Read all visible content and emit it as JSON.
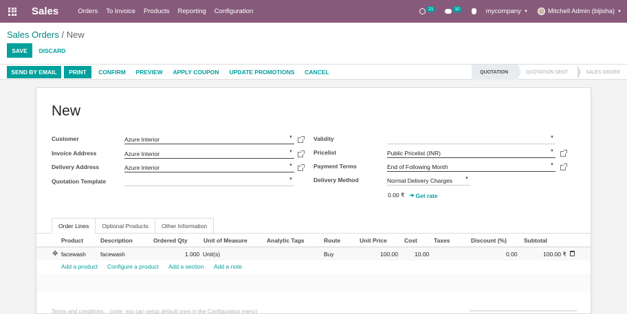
{
  "navbar": {
    "brand": "Sales",
    "menu": [
      "Orders",
      "To Invoice",
      "Products",
      "Reporting",
      "Configuration"
    ],
    "activity_count": "21",
    "messages_count": "10",
    "company": "mycompany",
    "user": "Mitchell Admin (bijisha)",
    "color": "#875a7b"
  },
  "control": {
    "breadcrumb_parent": "Sales Orders",
    "breadcrumb_sep": "/",
    "breadcrumb_current": "New",
    "save": "SAVE",
    "discard": "DISCARD"
  },
  "statusbar": {
    "send_by_email": "SEND BY EMAIL",
    "print": "PRINT",
    "confirm": "CONFIRM",
    "preview": "PREVIEW",
    "apply_coupon": "APPLY COUPON",
    "update_promotions": "UPDATE PROMOTIONS",
    "cancel": "CANCEL",
    "stages": [
      "QUOTATION",
      "QUOTATION SENT",
      "SALES ORDER"
    ],
    "active_stage": "QUOTATION"
  },
  "form": {
    "title": "New",
    "left": {
      "customer_label": "Customer",
      "customer_value": "Azure Interior",
      "invoice_label": "Invoice Address",
      "invoice_value": "Azure Interior",
      "delivery_label": "Delivery Address",
      "delivery_value": "Azure Interior",
      "template_label": "Quotation Template",
      "template_value": ""
    },
    "right": {
      "validity_label": "Validity",
      "validity_value": "",
      "pricelist_label": "Pricelist",
      "pricelist_value": "Public Pricelist (INR)",
      "payment_label": "Payment Terms",
      "payment_value": "End of Following Month",
      "delivery_method_label": "Delivery Method",
      "delivery_method_value": "Normal Delivery Charges",
      "rate_amount": "0.00 ₹",
      "get_rate": "Get rate"
    }
  },
  "tabs": [
    "Order Lines",
    "Optional Products",
    "Other Information"
  ],
  "table": {
    "headers": [
      "Product",
      "Description",
      "Ordered Qty",
      "Unit of Measure",
      "Analytic Tags",
      "Route",
      "Unit Price",
      "Cost",
      "Taxes",
      "Discount (%)",
      "Subtotal"
    ],
    "rows": [
      {
        "product": "facewash",
        "description": "facewash",
        "qty": "1.000",
        "uom": "Unit(s)",
        "analytic_tags": "",
        "route": "Buy",
        "unit_price": "100.00",
        "cost": "10.00",
        "taxes": "",
        "discount": "0.00",
        "subtotal": "100.00 ₹"
      }
    ],
    "add_product": "Add a product",
    "configure_product": "Configure a product",
    "add_section": "Add a section",
    "add_note": "Add a note"
  },
  "terms_placeholder": "Terms and conditions... (note: you can setup default ones in the Configuration menu)"
}
